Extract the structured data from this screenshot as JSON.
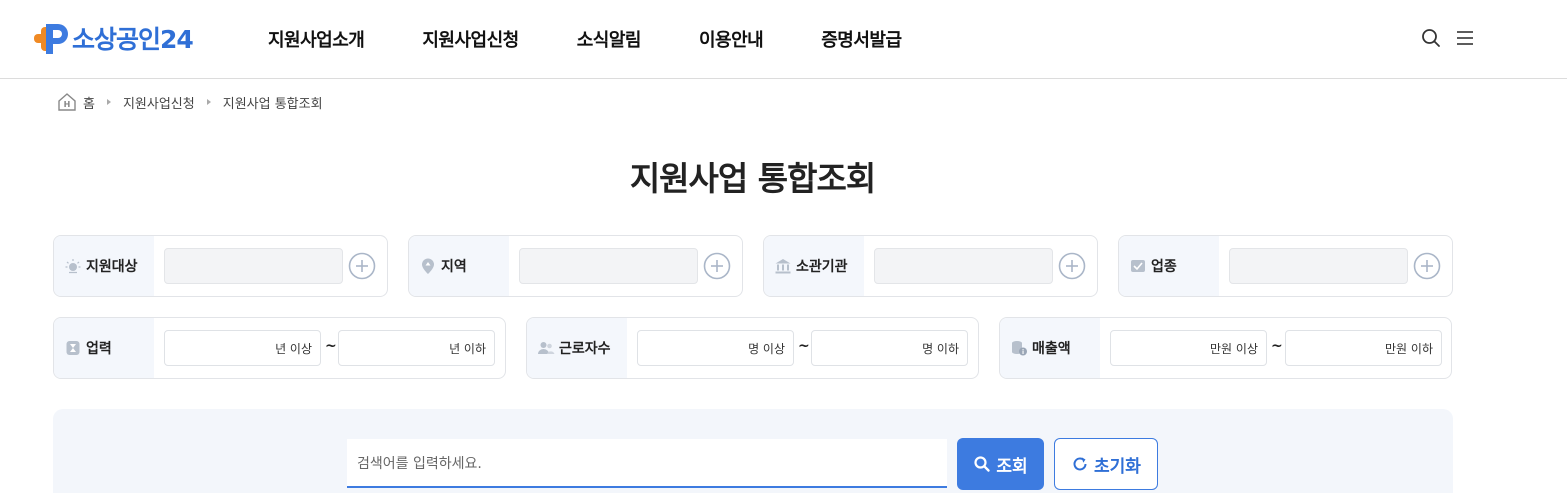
{
  "header": {
    "logo_text": "소상공인24",
    "nav": [
      "지원사업소개",
      "지원사업신청",
      "소식알림",
      "이용안내",
      "증명서발급"
    ],
    "icons": [
      "search-icon",
      "menu-icon"
    ]
  },
  "breadcrumb": [
    "홈",
    "지원사업신청",
    "지원사업 통합조회"
  ],
  "page_title": "지원사업 통합조회",
  "filters": {
    "support_target": {
      "label": "지원대상",
      "icon": "lightbulb-icon",
      "value": ""
    },
    "region": {
      "label": "지역",
      "icon": "location-pin-icon",
      "value": ""
    },
    "agency": {
      "label": "소관기관",
      "icon": "building-icon",
      "value": ""
    },
    "industry": {
      "label": "업종",
      "icon": "briefcase-icon",
      "value": ""
    }
  },
  "ranges": {
    "business_years": {
      "label": "업력",
      "icon": "hourglass-icon",
      "min_placeholder": "년 이상",
      "max_placeholder": "년 이하"
    },
    "employees": {
      "label": "근로자수",
      "icon": "people-icon",
      "min_placeholder": "명 이상",
      "max_placeholder": "명 이하"
    },
    "revenue": {
      "label": "매출액",
      "icon": "coins-icon",
      "min_placeholder": "만원 이상",
      "max_placeholder": "만원 이하"
    },
    "separator": "~"
  },
  "search": {
    "placeholder": "검색어를 입력하세요.",
    "search_button": "조회",
    "reset_button": "초기화"
  },
  "colors": {
    "brand_blue": "#3d7be0",
    "brand_orange": "#f08a24",
    "label_bg": "#f4f7fc"
  }
}
